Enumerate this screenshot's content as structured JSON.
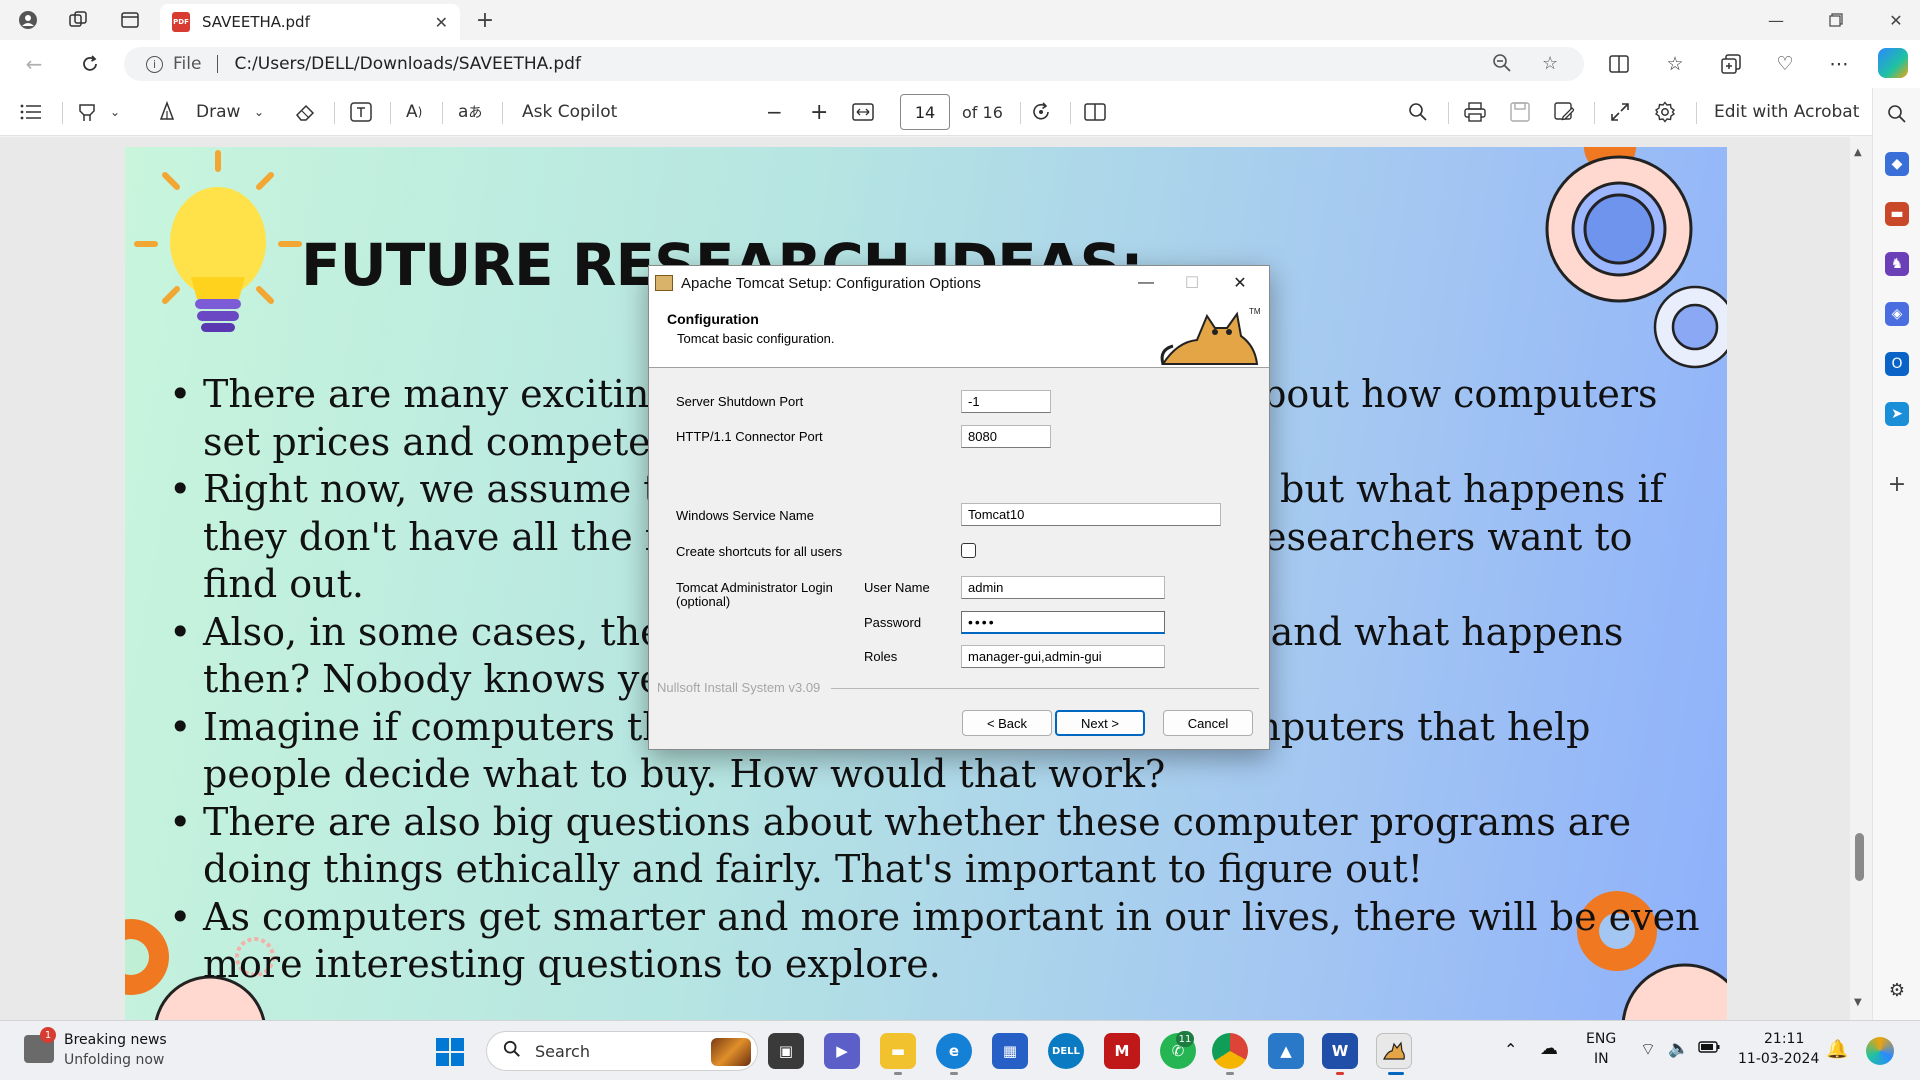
{
  "browser": {
    "tab_title": "SAVEETHA.pdf",
    "new_tab_symbol": "+",
    "file_label": "File",
    "url": "C:/Users/DELL/Downloads/SAVEETHA.pdf"
  },
  "toolbar": {
    "draw_label": "Draw",
    "ask_copilot_label": "Ask Copilot",
    "current_page": "14",
    "total_pages_label": "of 16",
    "edit_acrobat_label": "Edit with Acrobat"
  },
  "pdf": {
    "title": "FUTURE RESEARCH IDEAS:",
    "bullets": [
      "There are many exciting things to study in the future about how computers set prices and compete with each other.",
      "Right now, we assume the computers know everything, but what happens if they don't have all the information? That's something researchers want to find out.",
      "Also, in some cases, there might be unfair advantages, and what happens then? Nobody knows yet!",
      "Imagine if computers that sell things compete with computers that help people decide what to buy. How would that work?",
      "There are also big questions about whether these computer programs are doing things ethically and fairly. That's important to figure out!",
      "As computers get smarter and more important in our lives, there will be even more interesting questions to explore."
    ]
  },
  "dialog": {
    "title": "Apache Tomcat Setup: Configuration Options",
    "heading": "Configuration",
    "subheading": "Tomcat basic configuration.",
    "shutdown_port_label": "Server Shutdown Port",
    "shutdown_port_value": "-1",
    "http_port_label": "HTTP/1.1 Connector Port",
    "http_port_value": "8080",
    "service_name_label": "Windows Service Name",
    "service_name_value": "Tomcat10",
    "shortcuts_label": "Create shortcuts for all users",
    "shortcuts_checked": false,
    "admin_login_label": "Tomcat Administrator Login (optional)",
    "username_label": "User Name",
    "username_value": "admin",
    "password_label": "Password",
    "password_value": "••••",
    "roles_label": "Roles",
    "roles_value": "manager-gui,admin-gui",
    "installer_version": "Nullsoft Install System v3.09",
    "back_label": "< Back",
    "next_label": "Next >",
    "cancel_label": "Cancel"
  },
  "taskbar": {
    "news_title": "Breaking news",
    "news_subtitle": "Unfolding now",
    "news_badge": "1",
    "search_label": "Search",
    "whatsapp_badge": "11",
    "language": "ENG",
    "region": "IN",
    "time": "21:11",
    "date": "11-03-2024"
  },
  "colors": {
    "accent": "#0067c0",
    "pdf_red": "#d83b30",
    "page_gradient_start": "#c8f5dc",
    "page_gradient_end": "#8eb0fb"
  }
}
